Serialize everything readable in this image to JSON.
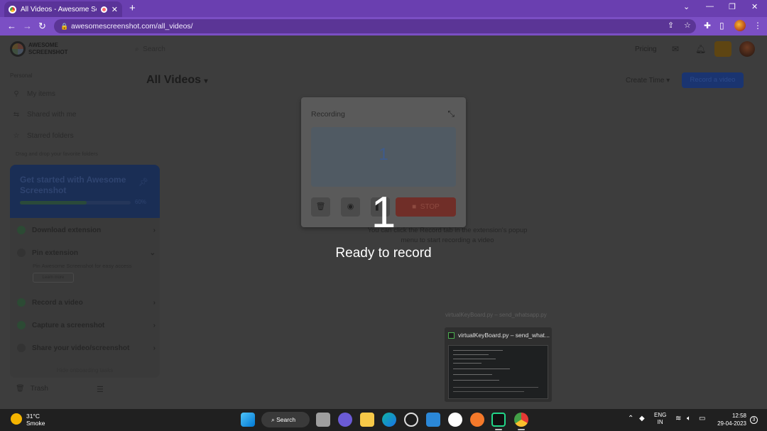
{
  "browser": {
    "tab_title": "All Videos - Awesome Screens",
    "url": "awesomescreenshot.com/all_videos/",
    "colors": {
      "titlebar": "#6a3fb0",
      "toolbar": "#7b4fc4"
    }
  },
  "app": {
    "logo_line1": "AWESOME",
    "logo_line2": "SCREENSHOT",
    "search_placeholder": "Search",
    "pricing": "Pricing",
    "page_title": "All Videos",
    "sort_label": "Create Time",
    "record_button": "Record a video",
    "empty_hint": "You can click the Record tab in the extension's popup menu to start recording a video"
  },
  "sidebar": {
    "section_label": "Personal",
    "items": [
      {
        "label": "My items",
        "icon": "person-icon"
      },
      {
        "label": "Shared with me",
        "icon": "share-icon"
      },
      {
        "label": "Starred folders",
        "icon": "star-icon"
      }
    ],
    "hint": "Drag and drop your favorite folders",
    "trash": "Trash"
  },
  "onboarding": {
    "title": "Get started with Awesome Screenshot",
    "progress_percent": 60,
    "progress_label": "60%",
    "tasks": [
      {
        "label": "Download extension",
        "done": true
      },
      {
        "label": "Pin extension",
        "done": false
      },
      {
        "label": "Record a video",
        "done": true
      },
      {
        "label": "Capture a screenshot",
        "done": true
      },
      {
        "label": "Share your video/screenshot",
        "done": false
      }
    ],
    "pin_desc": "Pin Awesome Screenshot for easy access",
    "pin_button": "Learn more",
    "footer": "Hide onboarding tasks"
  },
  "recording_widget": {
    "title": "Recording",
    "preview_count": "1",
    "stop_label": "STOP"
  },
  "countdown": {
    "number": "1",
    "label": "Ready to record"
  },
  "taskbar_preview": {
    "tooltip": "virtualKeyBoard.py – send_whatsapp.py",
    "window_title": "virtualKeyBoard.py – send_what..."
  },
  "taskbar": {
    "weather_temp": "31°C",
    "weather_desc": "Smoke",
    "search_label": "Search",
    "lang_line1": "ENG",
    "lang_line2": "IN",
    "time": "12:58",
    "date": "29-04-2023",
    "notification_count": "3"
  }
}
